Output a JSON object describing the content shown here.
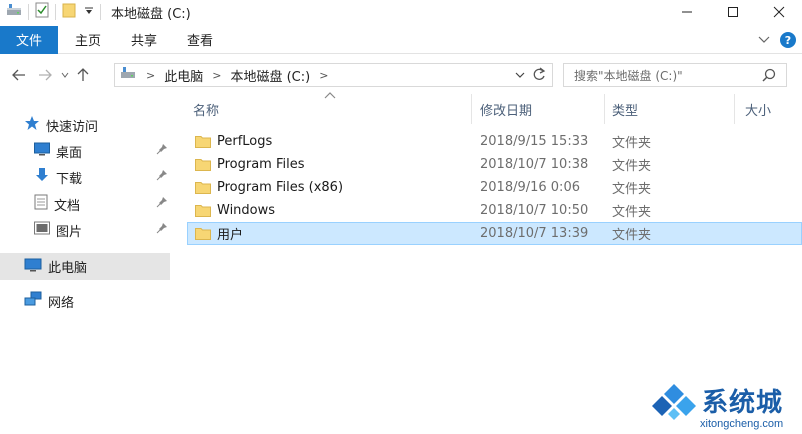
{
  "window": {
    "title": "本地磁盘 (C:)",
    "controls": {
      "minimize": "—",
      "maximize": "☐",
      "close": "✕"
    }
  },
  "ribbon": {
    "file_tab": "文件",
    "tabs": [
      "主页",
      "共享",
      "查看"
    ],
    "expand_icon": "chevron-down-icon",
    "help": "?"
  },
  "address": {
    "crumbs": [
      "此电脑",
      "本地磁盘 (C:)"
    ],
    "search_placeholder": "搜索\"本地磁盘 (C:)\""
  },
  "nav": {
    "quick_access": "快速访问",
    "pinned": [
      {
        "label": "桌面",
        "icon": "desktop-icon"
      },
      {
        "label": "下载",
        "icon": "download-icon"
      },
      {
        "label": "文档",
        "icon": "document-icon"
      },
      {
        "label": "图片",
        "icon": "pictures-icon"
      }
    ],
    "this_pc": "此电脑",
    "network": "网络"
  },
  "columns": {
    "name": "名称",
    "date": "修改日期",
    "type": "类型",
    "size": "大小"
  },
  "files": [
    {
      "name": "PerfLogs",
      "date": "2018/9/15 15:33",
      "type": "文件夹"
    },
    {
      "name": "Program Files",
      "date": "2018/10/7 10:38",
      "type": "文件夹"
    },
    {
      "name": "Program Files (x86)",
      "date": "2018/9/16 0:06",
      "type": "文件夹"
    },
    {
      "name": "Windows",
      "date": "2018/10/7 10:50",
      "type": "文件夹"
    },
    {
      "name": "用户",
      "date": "2018/10/7 13:39",
      "type": "文件夹",
      "selected": true
    }
  ],
  "watermark": {
    "text": "系统城",
    "url": "xitongcheng.com"
  },
  "colors": {
    "accent": "#1979ca",
    "selection": "#cce8ff",
    "folder": "#f7d674"
  }
}
